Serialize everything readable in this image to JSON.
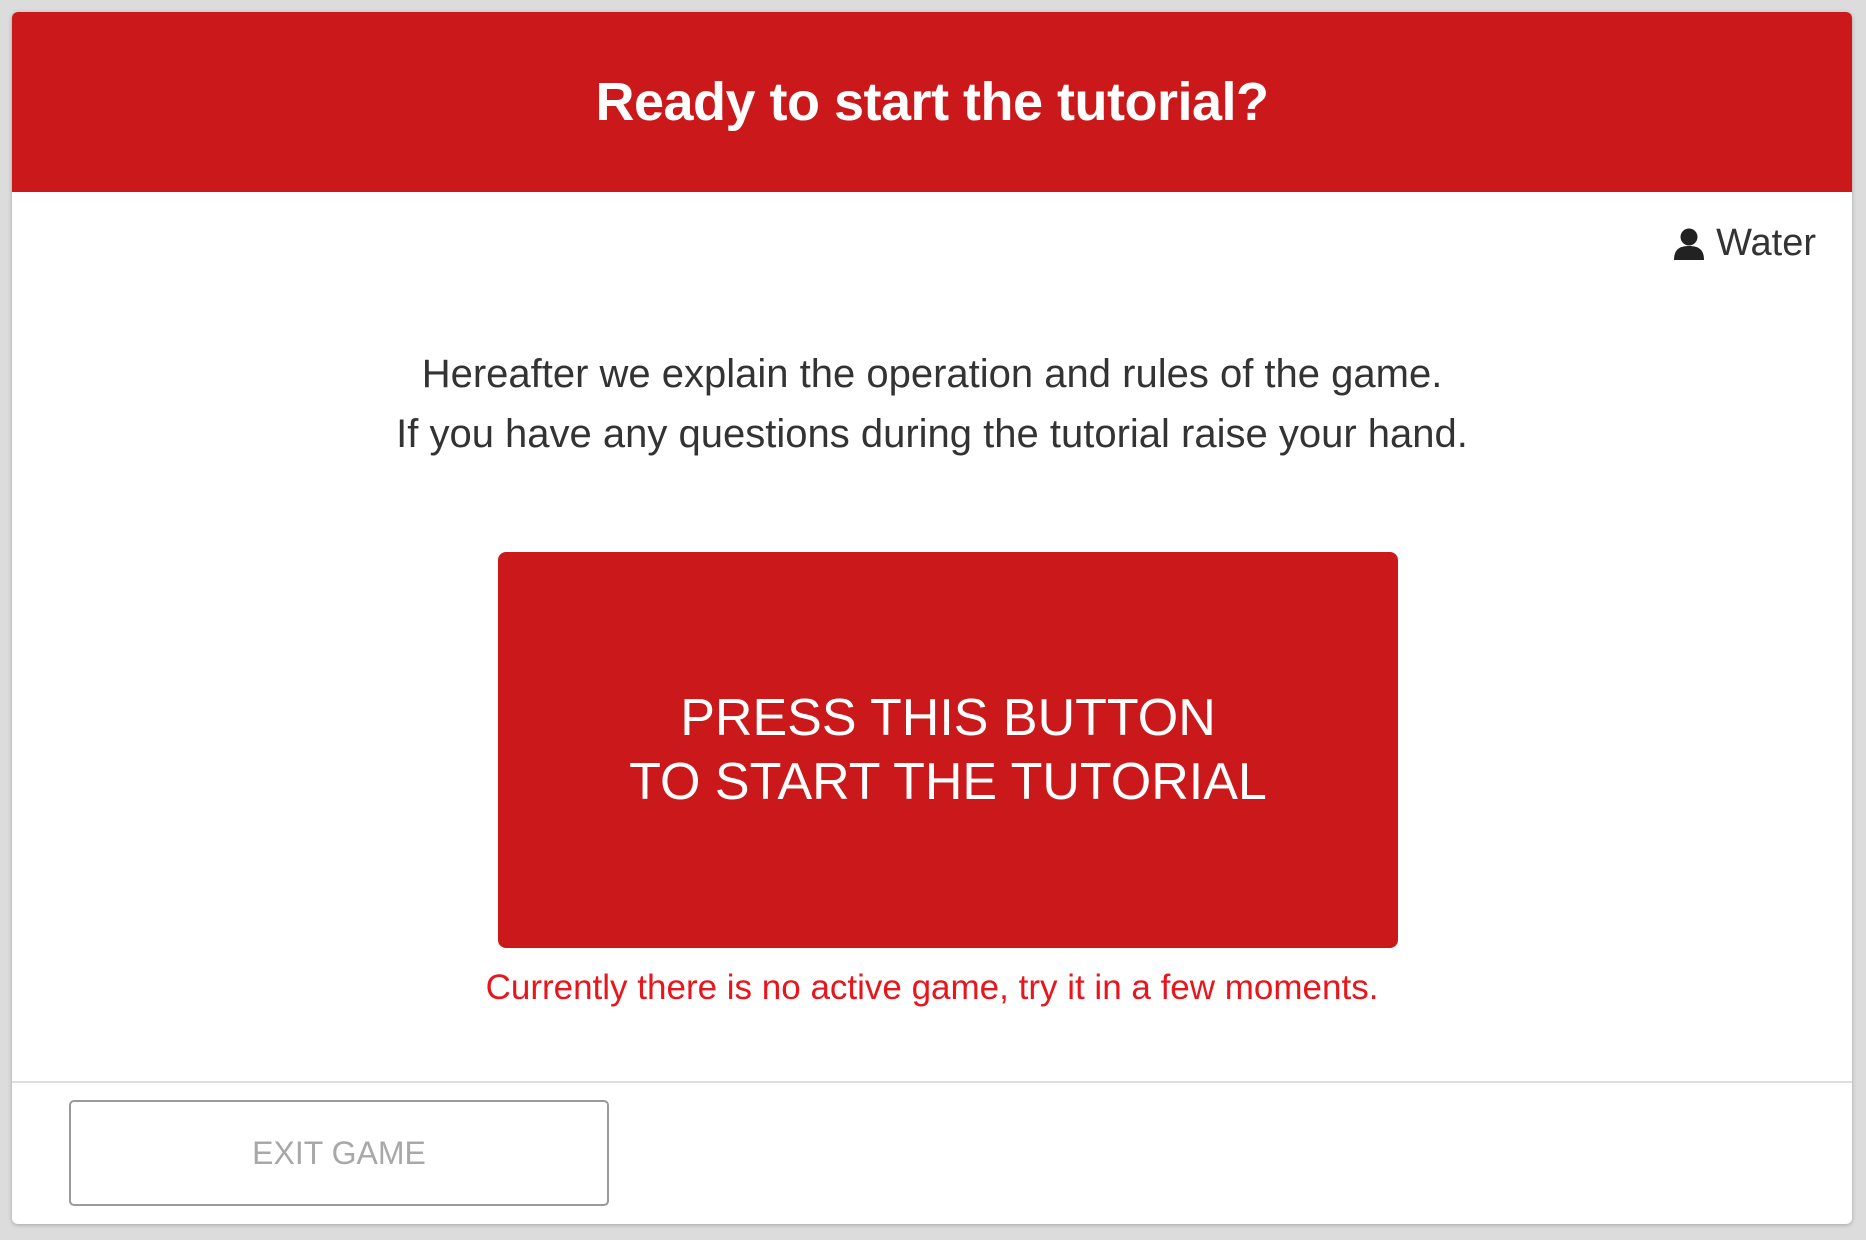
{
  "header": {
    "title": "Ready to start the tutorial?"
  },
  "user": {
    "icon": "user-icon",
    "name": "Water"
  },
  "intro": {
    "line1": "Hereafter we explain the operation and rules of the game.",
    "line2": "If you have any questions during the tutorial raise your hand."
  },
  "start_button": {
    "line1": "PRESS THIS BUTTON",
    "line2": "TO START THE TUTORIAL"
  },
  "status": {
    "message": "Currently there is no active game, try it in a few moments."
  },
  "footer": {
    "exit_label": "EXIT GAME"
  },
  "colors": {
    "brand_red": "#cb191b",
    "error_red": "#e8161c",
    "text_dark": "#333333",
    "muted_gray": "#a8a8a8"
  }
}
